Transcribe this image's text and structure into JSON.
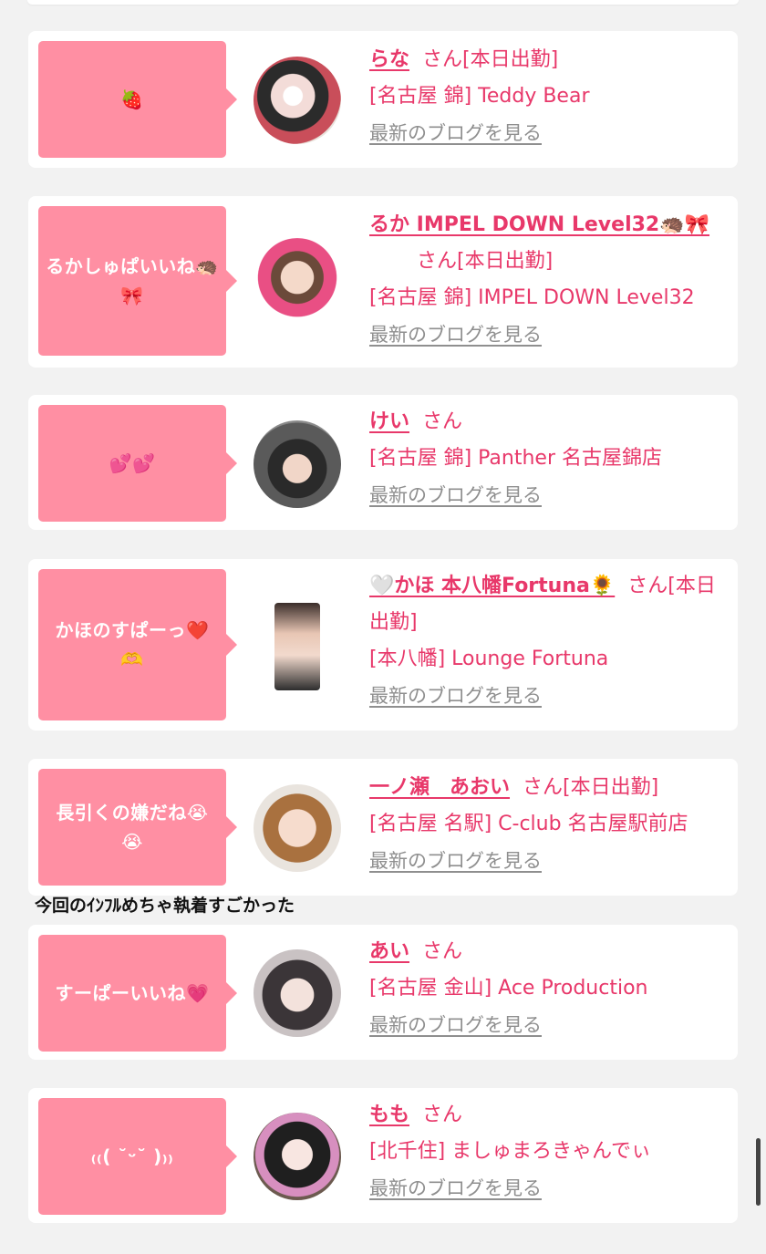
{
  "caption": "今回のｲﾝﾌﾙめちゃ執着すごかった",
  "blog_link_label": "最新のブログを見る",
  "entries": [
    {
      "comment": "🍓",
      "name": "らな",
      "suffix": "さん[本日出勤]",
      "shop": "[名古屋 錦] Teddy Bear"
    },
    {
      "comment": "るかしゅぱいいね🦔🎀",
      "name": "るか IMPEL DOWN Level32🦔🎀",
      "suffix": "さん[本日出勤]",
      "shop": "[名古屋 錦] IMPEL DOWN Level32"
    },
    {
      "comment": "💕💕",
      "name": "けい",
      "suffix": "さん",
      "shop": "[名古屋 錦] Panther 名古屋錦店"
    },
    {
      "comment": "かほのすぱーっ❤️🫶",
      "name": "🤍かほ 本八幡Fortuna🌻",
      "suffix": "さん[本日出勤]",
      "shop": "[本八幡] Lounge Fortuna"
    },
    {
      "comment": "長引くの嫌だね😭😭",
      "name": "一ノ瀬　あおい",
      "suffix": "さん[本日出勤]",
      "shop": "[名古屋 名駅] C-club 名古屋駅前店"
    },
    {
      "comment": "すーぱーいいね💗",
      "name": "あい",
      "suffix": "さん",
      "shop": "[名古屋 金山] Ace Production"
    },
    {
      "comment": "₍₍( ˘ᵕ˘ )₎₎",
      "name": "もも",
      "suffix": "さん",
      "shop": "[北千住] ましゅまろきゃんでぃ"
    }
  ],
  "colors": {
    "bubble": "#ff8fa3",
    "accent": "#e8386a",
    "link_gray": "#8f8f8f"
  }
}
